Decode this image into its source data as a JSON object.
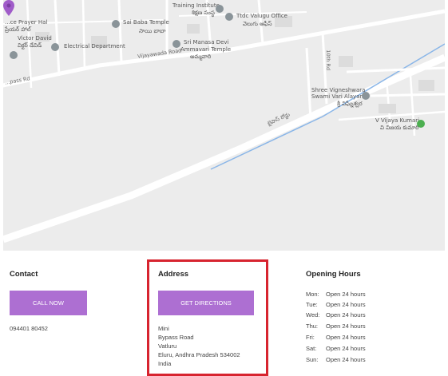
{
  "map": {
    "labels": {
      "prayer_hall": "...ce Prayer Hal",
      "prayer_hall_te": "ప్రేయర్ హాల్",
      "victor_david": "Victor David",
      "victor_david_te": "విక్టర్ డేవిడ్",
      "sai_baba": "Sai Baba Temple",
      "sai_baba_te": "సాయి బాబా",
      "training_institute": "Training Institute",
      "training_te": "శిక్షణ సంస్థ",
      "ttdc": "Ttdc Valugu Office",
      "ttdc_te": "వెలుగు ఆఫీస్",
      "electrical": "Electrical Department",
      "manasa_1": "Sri Manasa Devi",
      "manasa_2": "Ammavari Temple",
      "manasa_te": "అమ్మవారి",
      "vijayawada_rd": "Vijayawada Road",
      "palace_rd": "...pass Rd",
      "tenth_rd": "10th Rd",
      "vigneshwara_1": "Shree Vigneshwara",
      "vigneshwara_2": "Swami Vari Alayamu",
      "vigneshwara_te": "శ్రీ విఘ్నేశ్వర",
      "vijaya_kumari": "V Vijaya Kumari",
      "vijaya_kumari_te": "వి విజయ కుమారి",
      "bypass_te": "బైపాస్ రోడ్డు"
    },
    "pin_color": "#a05cc9"
  },
  "contact": {
    "title": "Contact",
    "button": "CALL NOW",
    "phone": "094401 80452"
  },
  "address": {
    "title": "Address",
    "button": "GET DIRECTIONS",
    "lines": [
      "Mini",
      "Bypass Road",
      "Vatluru",
      "Eluru, Andhra Pradesh 534002",
      "India"
    ]
  },
  "hours": {
    "title": "Opening Hours",
    "rows": [
      {
        "day": "Mon:",
        "value": "Open 24 hours"
      },
      {
        "day": "Tue:",
        "value": "Open 24 hours"
      },
      {
        "day": "Wed:",
        "value": "Open 24 hours"
      },
      {
        "day": "Thu:",
        "value": "Open 24 hours"
      },
      {
        "day": "Fri:",
        "value": "Open 24 hours"
      },
      {
        "day": "Sat:",
        "value": "Open 24 hours"
      },
      {
        "day": "Sun:",
        "value": "Open 24 hours"
      }
    ]
  },
  "colors": {
    "button": "#ad6fd2",
    "highlight": "#d7242f"
  }
}
